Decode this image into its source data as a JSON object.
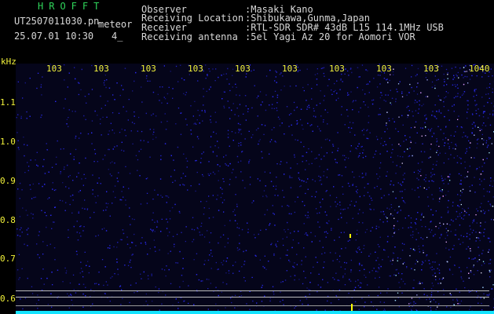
{
  "header": {
    "program": "HROFFT",
    "filename": "UT2507011030.pn",
    "mode": "meteor",
    "datetime": "25.07.01 10:30",
    "count": "4_",
    "fields": [
      {
        "label": "Observer",
        "value": ":Masaki Kano"
      },
      {
        "label": "Receiving Location",
        "value": ":Shibukawa,Gunma,Japan"
      },
      {
        "label": "Receiver",
        "value": ":RTL-SDR SDR# 43dB L15 114.1MHz USB"
      },
      {
        "label": "Receiving antenna",
        "value": ":5el Yagi Az 20 for Aomori VOR"
      }
    ]
  },
  "axis": {
    "unit": "kHz",
    "top_ticks": [
      "103",
      "103",
      "103",
      "103",
      "103",
      "103",
      "103",
      "103",
      "103",
      "1040"
    ],
    "y_ticks": [
      "1.1",
      "1.0",
      "0.9",
      "0.8",
      "0.7",
      "0.6"
    ]
  },
  "colors": {
    "background": "#000000",
    "noise": "#1a1ad0",
    "text": "#d8d8d8",
    "axis": "#f2f23a",
    "title": "#2fd35a",
    "baseline": "#14e3ff"
  }
}
